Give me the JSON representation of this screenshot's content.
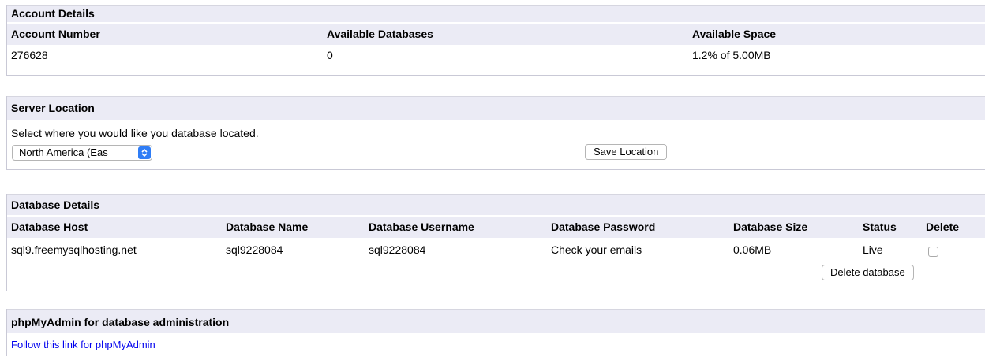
{
  "account": {
    "title": "Account Details",
    "headers": [
      "Account Number",
      "Available Databases",
      "Available Space"
    ],
    "values": [
      "276628",
      "0",
      "1.2% of 5.00MB"
    ]
  },
  "server": {
    "title": "Server Location",
    "prompt": "Select where you would like you database located.",
    "selected": "North America (Eas",
    "save_label": "Save Location"
  },
  "database": {
    "title": "Database Details",
    "headers": [
      "Database Host",
      "Database Name",
      "Database Username",
      "Database Password",
      "Database Size",
      "Status",
      "Delete"
    ],
    "row": [
      "sql9.freemysqlhosting.net",
      "sql9228084",
      "sql9228084",
      "Check your emails",
      "0.06MB",
      "Live"
    ],
    "delete_label": "Delete database"
  },
  "phpmyadmin": {
    "title": "phpMyAdmin for database administration",
    "link": "Follow this link for phpMyAdmin"
  },
  "colors": {
    "header_bg": "#ebebf5",
    "link": "#0000ee",
    "select_accent": "#2f7df6"
  }
}
